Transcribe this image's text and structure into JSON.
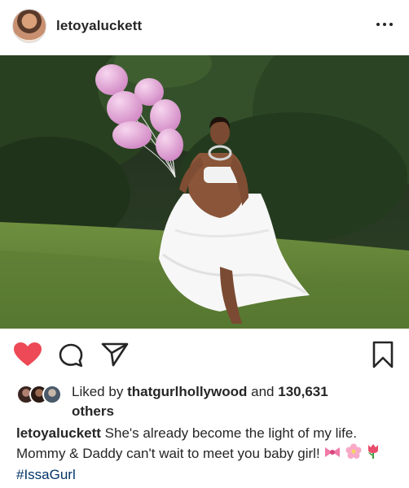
{
  "post": {
    "username": "letoyaluckett"
  },
  "likes": {
    "prefix": "Liked by",
    "liker": "thatgurlhollywood",
    "conjunction": "and",
    "count": "130,631",
    "suffix": "others"
  },
  "caption": {
    "username": "letoyaluckett",
    "text": "She's already become the light of my life. Mommy & Daddy can't wait to meet you baby girl!",
    "hashtag": "#IssaGurl"
  },
  "icons": {
    "like": "heart-icon",
    "comment": "comment-bubble-icon",
    "share": "paper-plane-icon",
    "save": "bookmark-icon",
    "more": "more-dots-icon"
  },
  "colors": {
    "like_active": "#ed4956",
    "text": "#262626",
    "hashtag": "#003569"
  }
}
